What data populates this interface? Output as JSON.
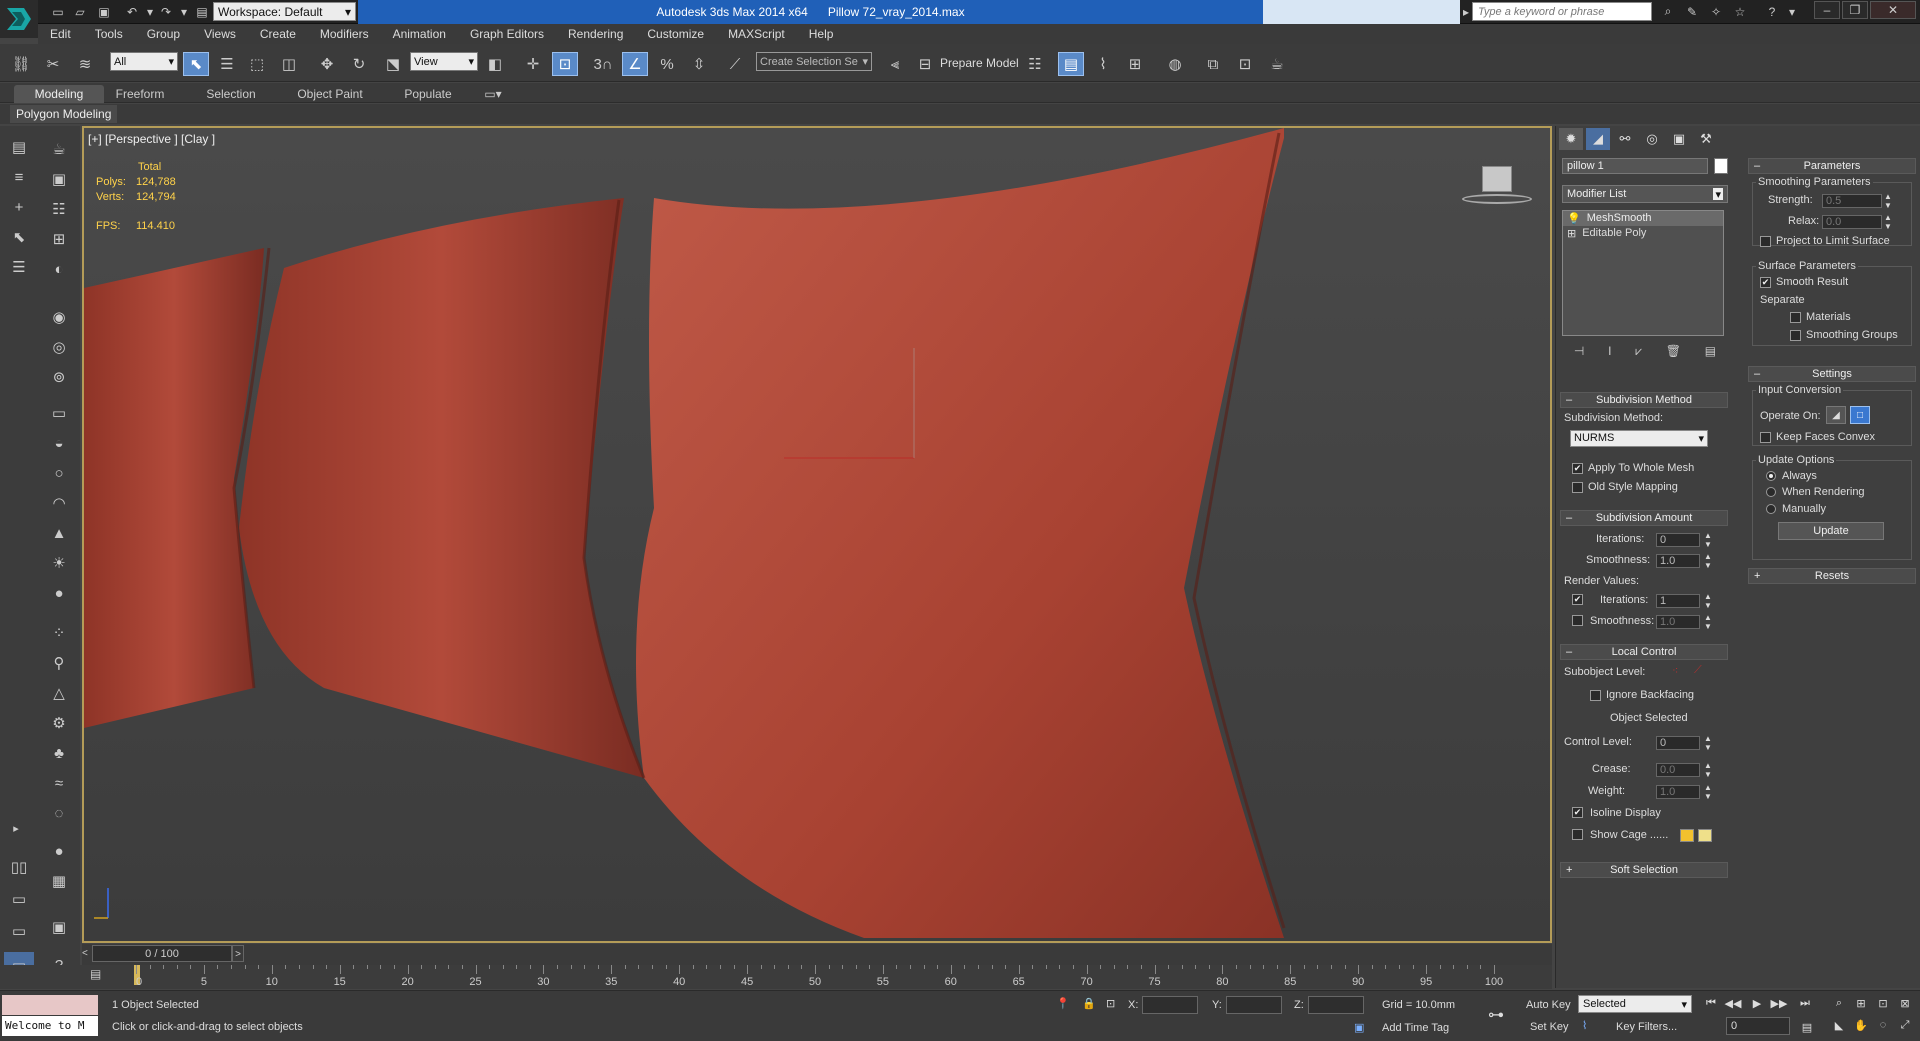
{
  "title": {
    "app": "Autodesk 3ds Max  2014 x64",
    "file": "Pillow 72_vray_2014.max",
    "workspace": "Workspace: Default",
    "search_placeholder": "Type a keyword or phrase"
  },
  "menu": [
    "Edit",
    "Tools",
    "Group",
    "Views",
    "Create",
    "Modifiers",
    "Animation",
    "Graph Editors",
    "Rendering",
    "Customize",
    "MAXScript",
    "Help"
  ],
  "toolbar": {
    "selection_filter": "All",
    "ref_coord": "View",
    "snap_num": "3",
    "named_selection": "Create Selection Se",
    "prepare_model": "Prepare Model"
  },
  "ribbon": {
    "tabs": [
      "Modeling",
      "Freeform",
      "Selection",
      "Object Paint",
      "Populate"
    ],
    "active_tab": "Modeling",
    "panel_label": "Polygon Modeling"
  },
  "viewport": {
    "label": "[+] [Perspective ] [Clay ]",
    "stats": {
      "total_label": "Total",
      "polys_label": "Polys:",
      "polys": "124,788",
      "verts_label": "Verts:",
      "verts": "124,794",
      "fps_label": "FPS:",
      "fps": "114.410"
    },
    "pillow_color": "#b24a3a"
  },
  "command_panel": {
    "object_name": "pillow 1",
    "modifier_list": "Modifier List",
    "stack": [
      "MeshSmooth",
      "Editable Poly"
    ],
    "subdivision_method": {
      "header": "Subdivision Method",
      "label": "Subdivision Method:",
      "value": "NURMS",
      "apply_whole_mesh": "Apply To Whole Mesh",
      "old_style": "Old Style Mapping"
    },
    "subdivision_amount": {
      "header": "Subdivision Amount",
      "iterations_label": "Iterations:",
      "iterations": "0",
      "smoothness_label": "Smoothness:",
      "smoothness": "1.0",
      "render_values": "Render Values:",
      "r_iterations_label": "Iterations:",
      "r_iterations": "1",
      "r_smoothness_label": "Smoothness:",
      "r_smoothness": "1.0"
    },
    "local_control": {
      "header": "Local Control",
      "subobject_level": "Subobject Level:",
      "ignore_backfacing": "Ignore Backfacing",
      "object_selected": "Object Selected",
      "control_level_label": "Control Level:",
      "control_level": "0",
      "crease_label": "Crease:",
      "crease": "0.0",
      "weight_label": "Weight:",
      "weight": "1.0",
      "isoline": "Isoline Display",
      "show_cage": "Show Cage ......"
    },
    "soft_selection": "Soft Selection"
  },
  "params_panel": {
    "parameters_header": "Parameters",
    "smoothing_params": "Smoothing Parameters",
    "strength_label": "Strength:",
    "strength": "0.5",
    "relax_label": "Relax:",
    "relax": "0.0",
    "project_limit": "Project to Limit Surface",
    "surface_params": "Surface Parameters",
    "smooth_result": "Smooth Result",
    "separate": "Separate",
    "materials": "Materials",
    "smoothing_groups": "Smoothing Groups",
    "settings_header": "Settings",
    "input_conversion": "Input Conversion",
    "operate_on": "Operate On:",
    "keep_faces_convex": "Keep Faces Convex",
    "update_options": "Update Options",
    "always": "Always",
    "when_rendering": "When Rendering",
    "manually": "Manually",
    "update_button": "Update",
    "resets_header": "Resets"
  },
  "timeline": {
    "slider": "0 / 100",
    "ticks": [
      "0",
      "5",
      "10",
      "15",
      "20",
      "25",
      "30",
      "35",
      "40",
      "45",
      "50",
      "55",
      "60",
      "65",
      "70",
      "75",
      "80",
      "85",
      "90",
      "95",
      "100"
    ]
  },
  "status": {
    "maxscript": "Welcome to M",
    "selected": "1 Object Selected",
    "prompt": "Click or click-and-drag to select objects",
    "x_label": "X:",
    "y_label": "Y:",
    "z_label": "Z:",
    "grid": "Grid = 10.0mm",
    "add_time_tag": "Add Time Tag",
    "auto_key": "Auto Key",
    "set_key": "Set Key",
    "selected_dd": "Selected",
    "key_filters": "Key Filters...",
    "frame": "0"
  },
  "colors": {
    "title_blue": "#2060b8",
    "viewport_border": "#b49c58",
    "cage_color_1": "#f2c12e",
    "cage_color_2": "#efe08a"
  }
}
